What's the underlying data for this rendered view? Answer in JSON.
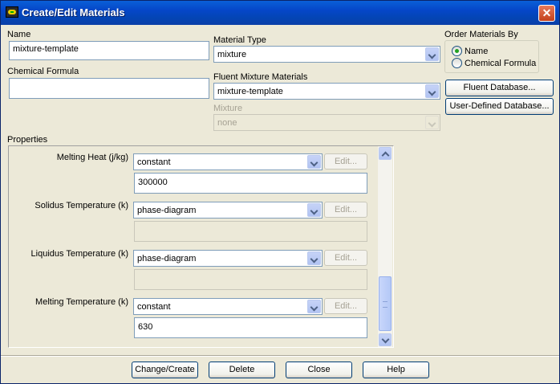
{
  "window": {
    "title": "Create/Edit Materials",
    "close_glyph": "✕"
  },
  "name": {
    "label": "Name",
    "value": "mixture-template"
  },
  "chemical_formula": {
    "label": "Chemical Formula",
    "value": ""
  },
  "material_type": {
    "label": "Material Type",
    "value": "mixture"
  },
  "fluent_mixture_materials": {
    "label": "Fluent Mixture Materials",
    "value": "mixture-template"
  },
  "mixture": {
    "label": "Mixture",
    "value": "none",
    "disabled": true
  },
  "order_by": {
    "label": "Order Materials By",
    "options": [
      {
        "label": "Name",
        "selected": true
      },
      {
        "label": "Chemical Formula",
        "selected": false
      }
    ]
  },
  "database_buttons": {
    "fluent": "Fluent Database...",
    "user_defined": "User-Defined Database..."
  },
  "properties": {
    "label": "Properties",
    "edit_label": "Edit...",
    "items": [
      {
        "label": "Melting Heat (j/kg)",
        "method": "constant",
        "value": "300000"
      },
      {
        "label": "Solidus Temperature (k)",
        "method": "phase-diagram",
        "value": ""
      },
      {
        "label": "Liquidus Temperature (k)",
        "method": "phase-diagram",
        "value": ""
      },
      {
        "label": "Melting Temperature (k)",
        "method": "constant",
        "value": "630"
      }
    ]
  },
  "footer": {
    "change_create": "Change/Create",
    "delete": "Delete",
    "close": "Close",
    "help": "Help"
  },
  "colors": {
    "titlebar": "#0546c8",
    "window_bg": "#ece9d8",
    "radio_dot": "#21a121"
  }
}
